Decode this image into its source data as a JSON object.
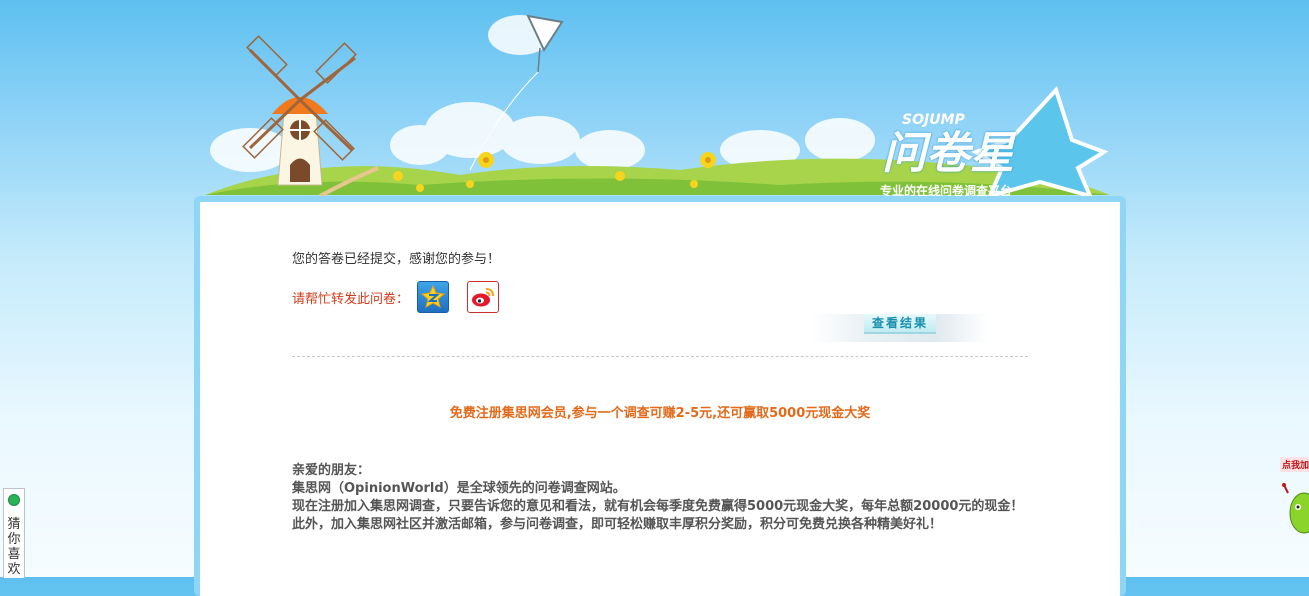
{
  "banner": {
    "logo_top": "SOJUMP",
    "logo_main": "问卷星",
    "logo_tagline": "专业的在线问卷调查平台"
  },
  "content": {
    "thanks_message": "您的答卷已经提交，感谢您的参与！",
    "share_label": "请帮忙转发此问卷：",
    "share_icons": [
      "qzone-icon",
      "weibo-icon"
    ],
    "view_results_label": "查看结果",
    "promo_headline": "免费注册集思网会员,参与一个调查可赚2-5元,还可赢取5000元现金大奖",
    "body_lines": [
      "亲爱的朋友：",
      "集思网（OpinionWorld）是全球领先的问卷调查网站。",
      "现在注册加入集思网调查，只要告诉您的意见和看法，就有机会每季度免费赢得5000元现金大奖，每年总额20000元的现金！",
      "此外，加入集思网社区并激活邮箱，参与问卷调查，即可轻松赚取丰厚积分奖励，积分可免费兑换各种精美好礼！"
    ]
  },
  "side_tab": {
    "label": "猜你喜欢"
  },
  "float_ad": {
    "label": "点我加"
  },
  "colors": {
    "sky_top": "#5ec0f0",
    "card_border": "#8fd6f6",
    "share_label": "#d23a1a",
    "promo": "#e36a1b",
    "body_text": "#555555",
    "result_tab_text": "#1a8fae"
  }
}
